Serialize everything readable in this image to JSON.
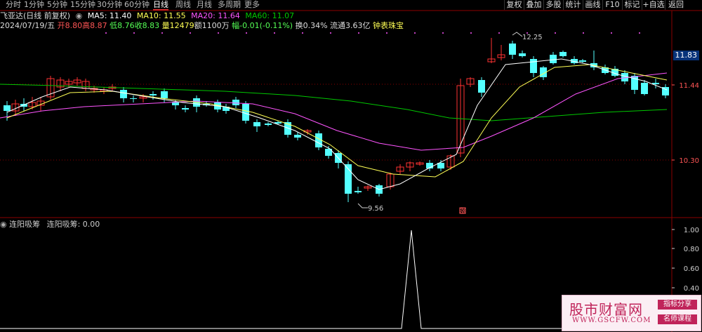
{
  "periods": [
    "分时",
    "1分钟",
    "5分钟",
    "15分钟",
    "30分钟",
    "60分钟",
    "日线",
    "周线",
    "月线",
    "多周期",
    "更多"
  ],
  "active_period": "日线",
  "right_buttons": [
    "复权",
    "叠加",
    "多股",
    "统计",
    "画线",
    "F10",
    "标记",
    "+自选",
    "返回"
  ],
  "header": {
    "title": "飞亚达(日线 前复权)",
    "ma5": "MA5: 11.40",
    "ma10": "MA10: 11.55",
    "ma20": "MA20: 11.64",
    "ma60": "MA60: 11.07",
    "date": "2024/07/19/五",
    "open": "开8.80",
    "high": "高8.87",
    "low": "低8.76",
    "close": "收8.83",
    "volume": "量12479",
    "amount": "额1100万",
    "change": "幅-0.01(-0.11%)",
    "turnover": "换0.34%",
    "float": "流通3.63亿",
    "concept": "钟表珠宝"
  },
  "price_axis": [
    "11.83",
    "11.44",
    "10.30"
  ],
  "annotations": {
    "high": "12.25",
    "low": "9.56",
    "rise_tag": "涨"
  },
  "indicator": {
    "name": "连阳吸筹",
    "label": "连阳吸筹: 0.00",
    "axis": [
      "1.00",
      "0.80",
      "0.60",
      "0.40",
      "0.20"
    ]
  },
  "colors": {
    "up": "#ff3232",
    "down": "#54ffff",
    "ma5": "#ffffff",
    "ma10": "#ffff55",
    "ma20": "#ff55ff",
    "ma60": "#00c800",
    "grid": "#8b0000",
    "indicator": "#ffffff"
  },
  "watermark": {
    "name": "股市财富网",
    "url": "WWW.GSCFW.COM",
    "tag1": "指标分享",
    "tag2": "名师课程"
  }
}
